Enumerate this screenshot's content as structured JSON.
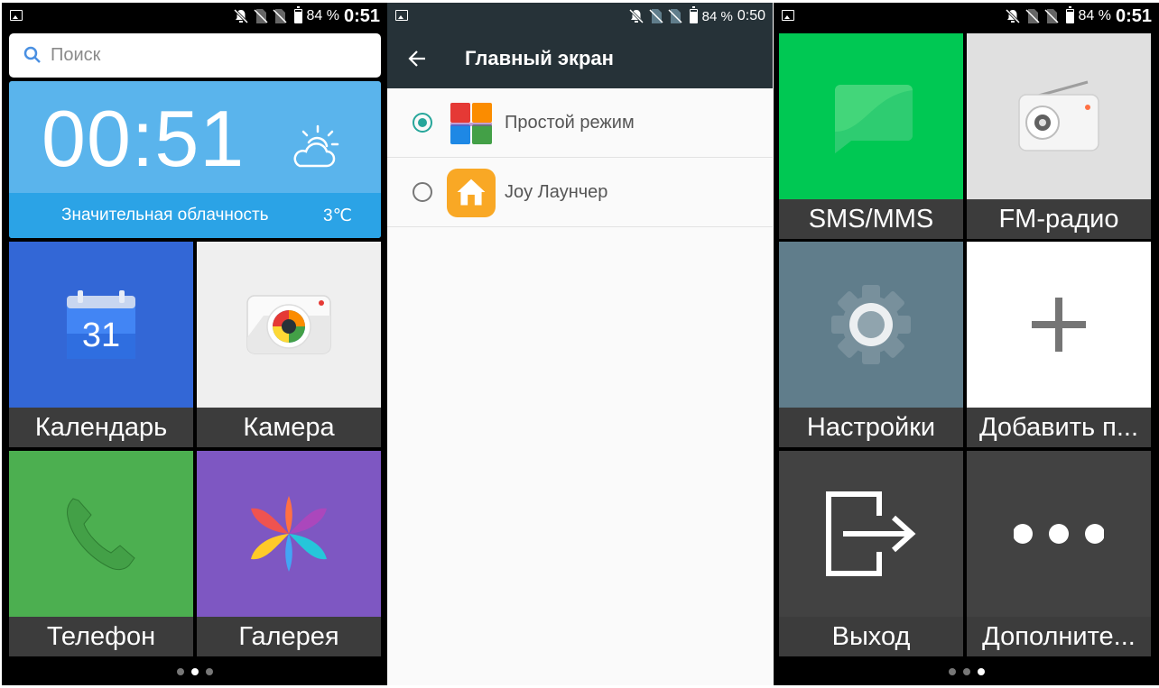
{
  "statusbar_left": {
    "battery": "84 %",
    "time": "0:51"
  },
  "statusbar_mid": {
    "battery": "84 %",
    "time": "0:50"
  },
  "statusbar_right": {
    "battery": "84 %",
    "time": "0:51"
  },
  "home": {
    "search_placeholder": "Поиск",
    "clock": {
      "time": "00:51",
      "condition": "Значительная облачность",
      "temperature": "3℃"
    },
    "tiles": [
      {
        "label": "Календарь",
        "icon": "calendar-icon",
        "color": "#3367d6",
        "date": "31"
      },
      {
        "label": "Камера",
        "icon": "camera-icon",
        "color": "#efefef"
      },
      {
        "label": "Телефон",
        "icon": "phone-icon",
        "color": "#4caf50"
      },
      {
        "label": "Галерея",
        "icon": "gallery-icon",
        "color": "#7e57c2"
      }
    ]
  },
  "settings": {
    "title": "Главный экран",
    "options": [
      {
        "label": "Простой режим",
        "selected": true
      },
      {
        "label": "Joy Лаунчер",
        "selected": false
      }
    ],
    "accent": "#26a69a"
  },
  "home2": {
    "tiles": [
      {
        "label": "SMS/MMS",
        "icon": "message-icon",
        "color": "#00c853"
      },
      {
        "label": "FM-радио",
        "icon": "radio-icon",
        "color": "#e0e0e0"
      },
      {
        "label": "Настройки",
        "icon": "gear-icon",
        "color": "#607d8b"
      },
      {
        "label": "Добавить п...",
        "icon": "plus-icon",
        "color": "#ffffff"
      },
      {
        "label": "Выход",
        "icon": "exit-icon",
        "color": "#424242"
      },
      {
        "label": "Дополните...",
        "icon": "more-icon",
        "color": "#424242"
      }
    ]
  }
}
